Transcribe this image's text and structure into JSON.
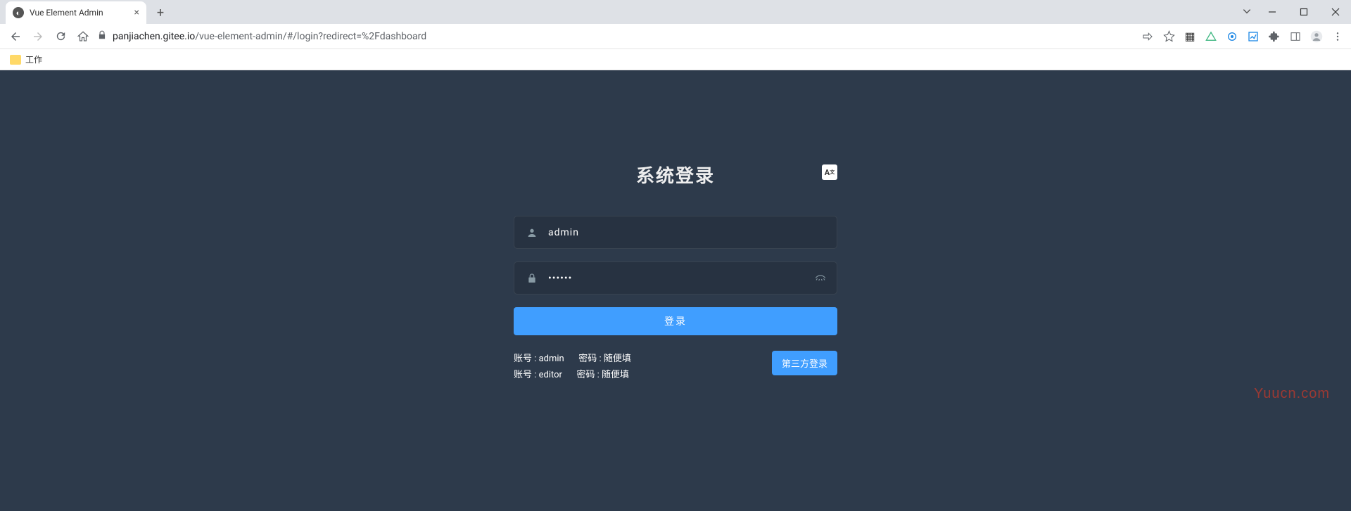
{
  "browser": {
    "tab_title": "Vue Element Admin",
    "url_host": "panjiachen.gitee.io",
    "url_path": "/vue-element-admin/#/login?redirect=%2Fdashboard",
    "bookmark": "工作"
  },
  "login": {
    "title": "系统登录",
    "lang_label": "A",
    "username_value": "admin",
    "password_value": "111111",
    "login_button": "登录",
    "third_party_button": "第三方登录",
    "tips": {
      "line1_account": "账号 : admin",
      "line1_password": "密码 : 随便填",
      "line2_account": "账号 : editor",
      "line2_password": "密码 : 随便填"
    }
  },
  "watermark": "Yuucn.com"
}
